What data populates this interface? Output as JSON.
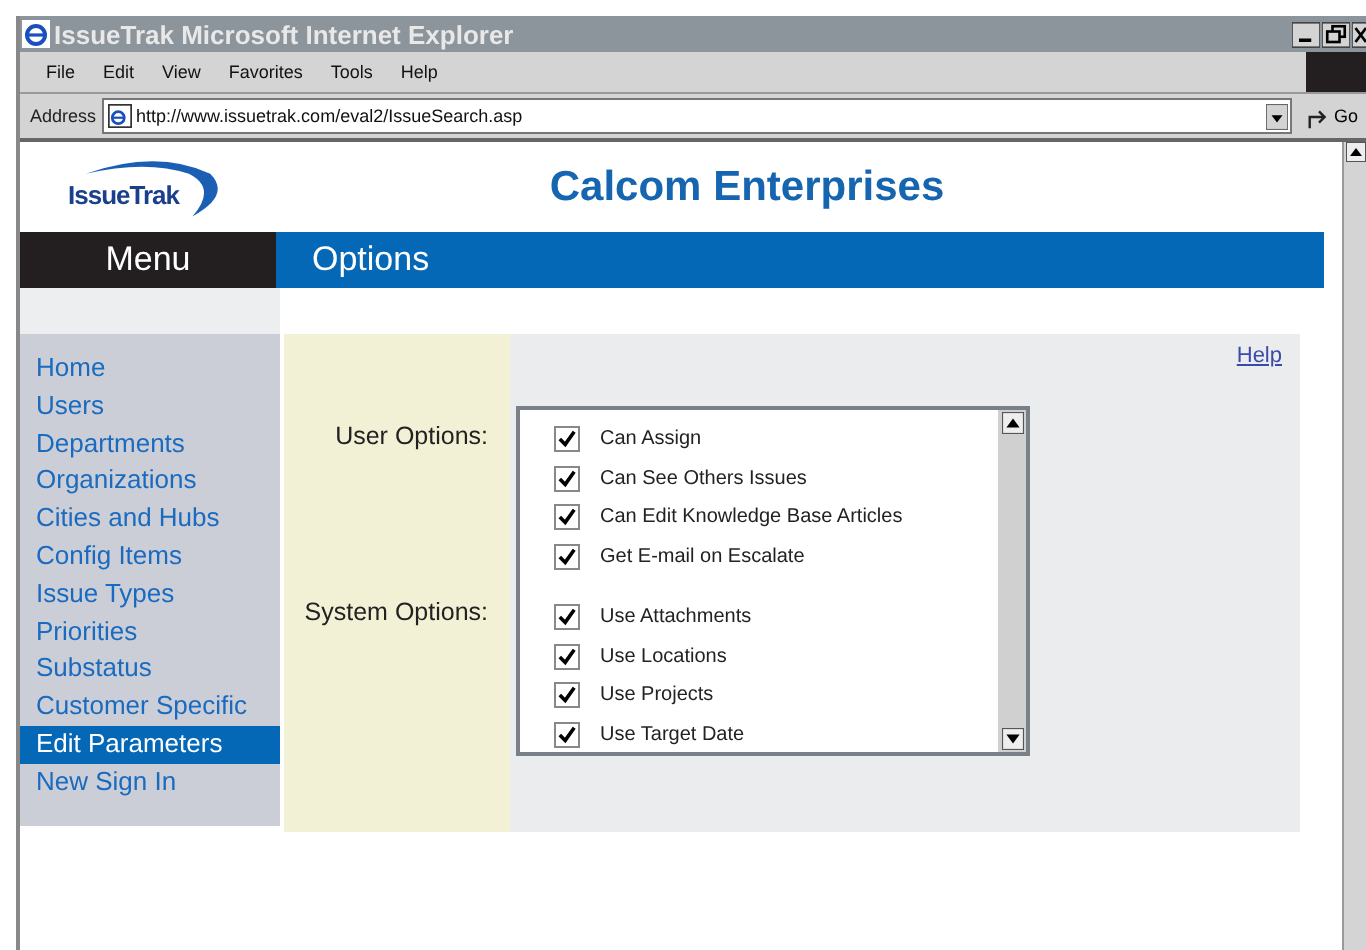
{
  "window": {
    "title": "IssueTrak Microsoft Internet Explorer"
  },
  "menu_bar": [
    "File",
    "Edit",
    "View",
    "Favorites",
    "Tools",
    "Help"
  ],
  "address_bar": {
    "label": "Address",
    "url": "http://www.issuetrak.com/eval2/IssueSearch.asp",
    "go": "Go"
  },
  "header": {
    "logo": "IssueTrak",
    "company": "Calcom Enterprises"
  },
  "nav": {
    "menu_label": "Menu",
    "section_title": "Options"
  },
  "sidebar": {
    "items": [
      {
        "label": "Home",
        "selected": false
      },
      {
        "label": "Users",
        "selected": false
      },
      {
        "label": "Departments",
        "selected": false
      },
      {
        "label": "Organizations",
        "selected": false
      },
      {
        "label": "Cities and Hubs",
        "selected": false
      },
      {
        "label": "Config Items",
        "selected": false
      },
      {
        "label": "Issue Types",
        "selected": false
      },
      {
        "label": "Priorities",
        "selected": false
      },
      {
        "label": "Substatus",
        "selected": false
      },
      {
        "label": "Customer Specific",
        "selected": false
      },
      {
        "label": "Edit Parameters",
        "selected": true
      },
      {
        "label": "New Sign In",
        "selected": false
      }
    ]
  },
  "help_link": "Help",
  "option_groups": [
    {
      "label": "User Options:",
      "options": [
        {
          "label": "Can Assign",
          "checked": true
        },
        {
          "label": "Can See Others Issues",
          "checked": true
        },
        {
          "label": "Can Edit Knowledge Base Articles",
          "checked": true
        },
        {
          "label": "Get E-mail on Escalate",
          "checked": true
        }
      ]
    },
    {
      "label": "System Options:",
      "options": [
        {
          "label": "Use Attachments",
          "checked": true
        },
        {
          "label": "Use Locations",
          "checked": true
        },
        {
          "label": "Use Projects",
          "checked": true
        },
        {
          "label": "Use Target Date",
          "checked": true
        }
      ]
    }
  ]
}
